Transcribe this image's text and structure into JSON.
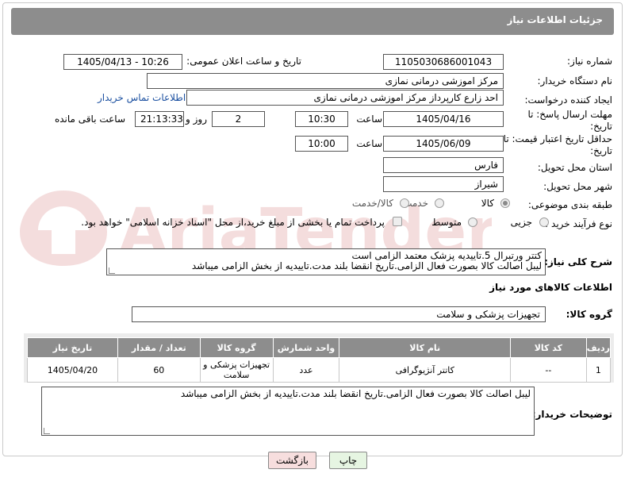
{
  "header": {
    "title": "جزئیات اطلاعات نیاز"
  },
  "form": {
    "need_number_label": "شماره نیاز:",
    "need_number": "1105030686001043",
    "announce_label": "تاریخ و ساعت اعلان عمومی:",
    "announce_value": "1405/04/13 - 10:26",
    "buyer_org_label": "نام دستگاه خریدار:",
    "buyer_org": "مرکز اموزشی درمانی نمازی",
    "creator_label": "ایجاد کننده درخواست:",
    "creator": "احد زارع کارپرداز مرکز اموزشی درمانی نمازی",
    "contact_link": "اطلاعات تماس خریدار",
    "deadline_label": "مهلت ارسال پاسخ: تا تاریخ:",
    "deadline_date": "1405/04/16",
    "time_label": "ساعت",
    "deadline_time": "10:30",
    "days": "2",
    "days_label": "روز و",
    "remaining": "21:13:33",
    "remaining_label": "ساعت باقی مانده",
    "price_valid_label": "حداقل تاریخ اعتبار قیمت: تا تاریخ:",
    "price_valid_date": "1405/06/09",
    "price_valid_time": "10:00",
    "province_label": "استان محل تحویل:",
    "province": "فارس",
    "city_label": "شهر محل تحویل:",
    "city": "شیراز",
    "category_label": "طبقه بندی موضوعی:",
    "category_options": [
      "کالا",
      "خدمت",
      "کالا/خدمت"
    ],
    "purchase_type_label": "نوع فرآیند خرید :",
    "purchase_options": [
      "جزیی",
      "متوسط"
    ],
    "payment_note": "پرداخت تمام یا بخشی از مبلغ خرید،از محل \"اسناد خزانه اسلامی\" خواهد بود.",
    "description_label": "شرح کلی نیاز:",
    "description_line1": "کتتر ورتبرال 5.تاییدیه پزشک معتمد الزامی است",
    "description_line2": "لیبل اصالت کالا بصورت فعال الزامی.تاریخ انقضا بلند مدت.تاییدیه از بخش الزامی میباشد"
  },
  "goods": {
    "section_title": "اطلاعات کالاهای مورد نیاز",
    "group_label": "گروه کالا:",
    "group_value": "تجهیزات پزشکی و سلامت",
    "columns": [
      "ردیف",
      "کد کالا",
      "نام کالا",
      "واحد شمارش",
      "گروه کالا",
      "تعداد / مقدار",
      "تاریخ نیاز"
    ],
    "rows": [
      [
        "1",
        "--",
        "کاتتر آنژیوگرافی",
        "عدد",
        "تجهیزات پزشکی و سلامت",
        "60",
        "1405/04/20"
      ]
    ]
  },
  "buyer_notes": {
    "label": "توضیحات خریدار:",
    "text": "لیبل اصالت کالا بصورت فعال الزامی.تاریخ انقضا بلند مدت.تاییدیه از بخش الزامی میباشد"
  },
  "buttons": {
    "print": "چاپ",
    "back": "بازگشت"
  },
  "watermark": {
    "text": "AriaTender.net"
  },
  "colors": {
    "header_bg": "#8d8d8d",
    "link": "#1a4fa0",
    "print_bg": "#e6f5e2",
    "back_bg": "#f7dede"
  }
}
